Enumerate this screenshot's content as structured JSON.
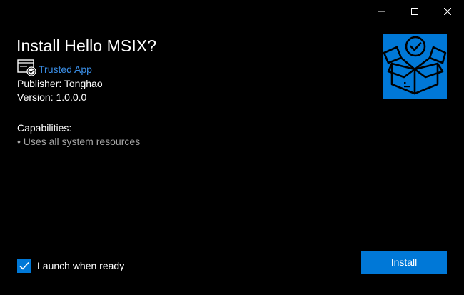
{
  "window": {
    "caption": {
      "minimize_icon": "minimize-icon",
      "maximize_icon": "maximize-icon",
      "close_icon": "close-icon"
    }
  },
  "main": {
    "title": "Install Hello MSIX?",
    "trusted_label": "Trusted App",
    "trusted_icon": "certificate-icon",
    "publisher": "Publisher: Tonghao",
    "version": "Version: 1.0.0.0",
    "capabilities_header": "Capabilities:",
    "capabilities": [
      "• Uses all system resources"
    ],
    "app_logo_icon": "package-box-icon"
  },
  "footer": {
    "launch_checkbox_checked": true,
    "launch_label": "Launch when ready",
    "install_label": "Install"
  },
  "colors": {
    "background": "#000000",
    "accent": "#0078d7",
    "link": "#3a8ee6",
    "muted_text": "#a6a6a6"
  }
}
